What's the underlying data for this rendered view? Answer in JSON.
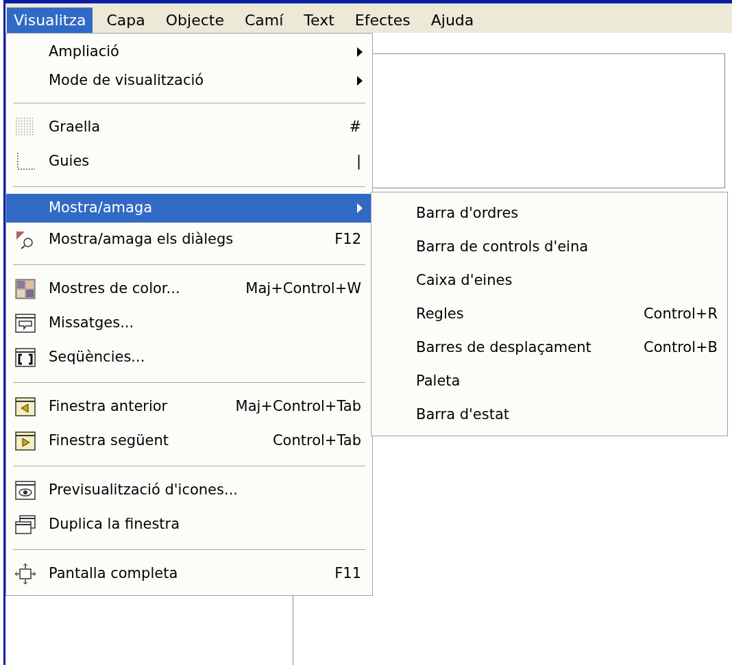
{
  "menu_bar": [
    {
      "label": "Visualitza",
      "selected": true
    },
    {
      "label": "Capa",
      "selected": false
    },
    {
      "label": "Objecte",
      "selected": false
    },
    {
      "label": "Camí",
      "selected": false
    },
    {
      "label": "Text",
      "selected": false
    },
    {
      "label": "Efectes",
      "selected": false
    },
    {
      "label": "Ajuda",
      "selected": false
    }
  ],
  "menu": {
    "items": [
      {
        "kind": "item",
        "label": "Ampliació",
        "submenu": true,
        "selected": false
      },
      {
        "kind": "item",
        "label": "Mode de visualització",
        "submenu": true,
        "selected": false
      },
      {
        "kind": "separator"
      },
      {
        "kind": "item",
        "label": "Graella",
        "shortcut": "#",
        "selected": false
      },
      {
        "kind": "item",
        "label": "Guies",
        "shortcut": "|",
        "selected": false
      },
      {
        "kind": "separator"
      },
      {
        "kind": "item",
        "label": "Mostra/amaga",
        "submenu": true,
        "selected": true
      },
      {
        "kind": "item",
        "label": "Mostra/amaga els diàlegs",
        "shortcut": "F12",
        "selected": false
      },
      {
        "kind": "separator"
      },
      {
        "kind": "item",
        "label": "Mostres de color...",
        "shortcut": "Maj+Control+W",
        "selected": false
      },
      {
        "kind": "item",
        "label": "Missatges...",
        "selected": false
      },
      {
        "kind": "item",
        "label": "Seqüències...",
        "selected": false
      },
      {
        "kind": "separator"
      },
      {
        "kind": "item",
        "label": "Finestra anterior",
        "shortcut": "Maj+Control+Tab",
        "selected": false
      },
      {
        "kind": "item",
        "label": "Finestra següent",
        "shortcut": "Control+Tab",
        "selected": false
      },
      {
        "kind": "separator"
      },
      {
        "kind": "item",
        "label": "Previsualització d'icones...",
        "selected": false
      },
      {
        "kind": "item",
        "label": "Duplica la finestra",
        "selected": false
      },
      {
        "kind": "separator"
      },
      {
        "kind": "item",
        "label": "Pantalla completa",
        "shortcut": "F11",
        "selected": false
      }
    ]
  },
  "submenu": {
    "items": [
      {
        "label": "Barra d'ordres",
        "selected": false
      },
      {
        "label": "Barra de controls d'eina",
        "selected": false
      },
      {
        "label": "Caixa d'eines",
        "selected": false
      },
      {
        "label": "Regles",
        "shortcut": "Control+R",
        "selected": false
      },
      {
        "label": "Barres de desplaçament",
        "shortcut": "Control+B",
        "selected": false
      },
      {
        "label": "Paleta",
        "selected": false
      },
      {
        "label": "Barra d'estat",
        "selected": false
      }
    ]
  }
}
